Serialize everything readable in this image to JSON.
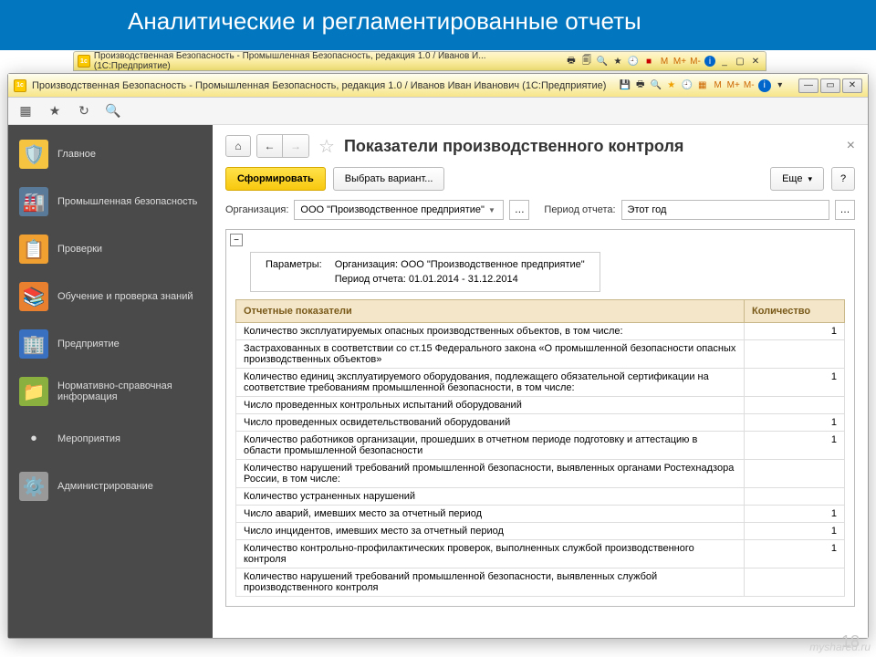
{
  "slide_title": "Аналитические и регламентированные отчеты",
  "outer_title": "Производственная Безопасность - Промышленная Безопасность, редакция 1.0 / Иванов И...  (1С:Предприятие)",
  "main_title": "Производственная Безопасность - Промышленная Безопасность, редакция 1.0 / Иванов Иван Иванович  (1С:Предприятие)",
  "sidebar": {
    "items": [
      {
        "label": "Главное",
        "icon": "🛡️",
        "bg": "#f5c542"
      },
      {
        "label": "Промышленная безопасность",
        "icon": "🏭",
        "bg": "#5a7a9a"
      },
      {
        "label": "Проверки",
        "icon": "📋",
        "bg": "#f0a030"
      },
      {
        "label": "Обучение и проверка знаний",
        "icon": "📚",
        "bg": "#e88030"
      },
      {
        "label": "Предприятие",
        "icon": "🏢",
        "bg": "#3a70c0"
      },
      {
        "label": "Нормативно-справочная информация",
        "icon": "📁",
        "bg": "#8ab040"
      },
      {
        "label": "Мероприятия",
        "icon": "•",
        "bg": "transparent"
      },
      {
        "label": "Администрирование",
        "icon": "⚙️",
        "bg": "#999"
      }
    ]
  },
  "page": {
    "title": "Показатели производственного контроля",
    "form_btn": "Сформировать",
    "variant_btn": "Выбрать вариант...",
    "more_btn": "Еще",
    "help_btn": "?",
    "org_label": "Организация:",
    "org_value": "ООО \"Производственное предприятие\"",
    "period_label": "Период отчета:",
    "period_value": "Этот год",
    "params_label": "Параметры:",
    "params_org": "Организация: ООО \"Производственное предприятие\"",
    "params_period": "Период отчета: 01.01.2014 - 31.12.2014",
    "col_indicator": "Отчетные показатели",
    "col_qty": "Количество",
    "rows": [
      {
        "t": "Количество эксплуатируемых опасных производственных объектов, в том числе:",
        "v": "1"
      },
      {
        "t": "Застрахованных в соответствии  со ст.15  Федерального закона  «О промышленной безопасности опасных производственных объектов»",
        "v": ""
      },
      {
        "t": "Количество единиц эксплуатируемого оборудования, подлежащего обязательной сертификации на соответствие требованиям промышленной безопасности, в том числе:",
        "v": "1"
      },
      {
        "t": "Число проведенных контрольных испытаний оборудований",
        "v": ""
      },
      {
        "t": "Число проведенных освидетельствований оборудований",
        "v": "1"
      },
      {
        "t": "Количество работников организации, прошедших в отчетном периоде подготовку и аттестацию в области промышленной безопасности",
        "v": "1"
      },
      {
        "t": "Количество нарушений требований промышленной безопасности, выявленных  органами Ростехнадзора России, в том числе:",
        "v": ""
      },
      {
        "t": "Количество  устраненных нарушений",
        "v": ""
      },
      {
        "t": "Число аварий, имевших место за отчетный период",
        "v": "1"
      },
      {
        "t": "Число инцидентов, имевших место за отчетный период",
        "v": "1"
      },
      {
        "t": "Количество контрольно-профилактических проверок, выполненных службой производственного контроля",
        "v": "1"
      },
      {
        "t": "Количество нарушений требований промышленной безопасности, выявленных службой производственного контроля",
        "v": ""
      }
    ]
  },
  "page_num": "18",
  "watermark": "myshared.ru"
}
